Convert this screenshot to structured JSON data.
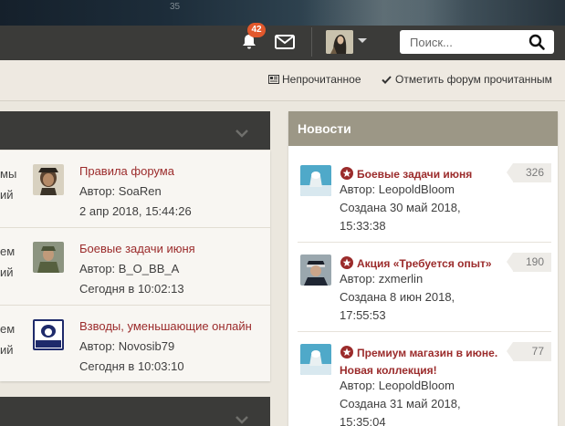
{
  "banner": {
    "number": "35"
  },
  "navbar": {
    "notifications_count": "42",
    "icons": {
      "notifications": "bell-icon",
      "messages": "envelope-icon",
      "search": "magnifier-icon",
      "menu": "caret-down-icon"
    },
    "search_placeholder": "Поиск..."
  },
  "actions": {
    "unread_label": "Непрочитанное",
    "mark_read_label": "Отметить форум прочитанным"
  },
  "forum_rows": [
    {
      "left_line1": "мы",
      "left_line2": "ий",
      "title": "Правила форума",
      "author": "Автор: SoaRen",
      "date": "2 апр 2018, 15:44:26"
    },
    {
      "left_line1": "ем",
      "left_line2": "ий",
      "title": "Боевые задачи июня",
      "author": "Автор: B_O_BB_A",
      "date": "Сегодня в 10:02:13"
    },
    {
      "left_line1": "ем",
      "left_line2": "ий",
      "title": "Взводы, уменьшающие онлайн",
      "author": "Автор: Novosib79",
      "date": "Сегодня в 10:03:10"
    }
  ],
  "news": {
    "header": "Новости",
    "items": [
      {
        "title": "Боевые задачи июня",
        "author": "Автор: LeopoldBloom",
        "created_line1": "Создана 30 май 2018,",
        "created_line2": "15:33:38",
        "count": "326"
      },
      {
        "title": "Акция «Требуется опыт»",
        "author": "Автор: zxmerlin",
        "created_line1": "Создана 8 июн 2018,",
        "created_line2": "17:55:53",
        "count": "190"
      },
      {
        "title": "Премиум магазин в июне. Новая коллекция!",
        "author": "Автор: LeopoldBloom",
        "created_line1": "Создана 31 май 2018,",
        "created_line2": "15:35:04",
        "count": "77"
      }
    ]
  },
  "colors": {
    "accent_link": "#9b2b2b",
    "navbar": "#3b3b39",
    "news_header": "#9c9786",
    "badge": "#e2582c"
  }
}
